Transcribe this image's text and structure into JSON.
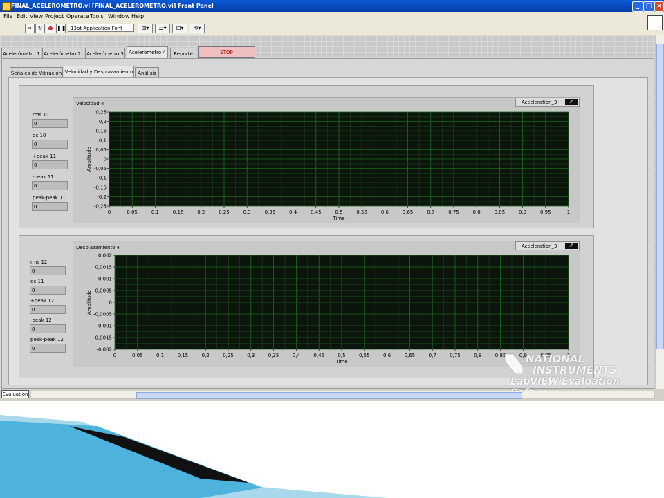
{
  "window": {
    "title": "FINAL_ACELEROMETRO.vi [FINAL_ACELEROMETRO.vi] Front Panel"
  },
  "menu": [
    "File",
    "Edit",
    "View",
    "Project",
    "Operate",
    "Tools",
    "Window",
    "Help"
  ],
  "toolbar": {
    "font": "13pt Application Font"
  },
  "tabs": [
    {
      "label": "Acelerómetro 1",
      "active": false
    },
    {
      "label": "Acelerómetro 2",
      "active": false
    },
    {
      "label": "Acelerómetro 3",
      "active": false
    },
    {
      "label": "Acelerómetro 4",
      "active": true
    },
    {
      "label": "Reporte",
      "active": false
    }
  ],
  "stop_label": "STOP",
  "subtabs": [
    {
      "label": "Señales de Vibración",
      "active": false
    },
    {
      "label": "Velocidad y Desplazamiento",
      "active": true
    },
    {
      "label": "Análisis",
      "active": false
    }
  ],
  "velocity_panel": {
    "indicators": [
      {
        "label": "rms 11",
        "value": "0"
      },
      {
        "label": "dc 10",
        "value": "0"
      },
      {
        "label": "+peak 11",
        "value": "0"
      },
      {
        "label": "-peak 11",
        "value": "0"
      },
      {
        "label": "peak-peak 11",
        "value": "0"
      }
    ],
    "legend": "Acceleration_3"
  },
  "displacement_panel": {
    "indicators": [
      {
        "label": "rms 12",
        "value": "0"
      },
      {
        "label": "dc 11",
        "value": "0"
      },
      {
        "label": "+peak 12",
        "value": "0"
      },
      {
        "label": "-peak 12",
        "value": "0"
      },
      {
        "label": "peak-peak 12",
        "value": "0"
      }
    ],
    "legend": "Acceleration_3"
  },
  "chart_data": [
    {
      "type": "line",
      "title": "Velocidad 4",
      "xlabel": "Time",
      "ylabel": "Amplitude",
      "xlim": [
        0,
        1
      ],
      "ylim": [
        -0.25,
        0.25
      ],
      "xticks": [
        "0",
        "0,05",
        "0,1",
        "0,15",
        "0,2",
        "0,25",
        "0,3",
        "0,35",
        "0,4",
        "0,45",
        "0,5",
        "0,55",
        "0,6",
        "0,65",
        "0,7",
        "0,75",
        "0,8",
        "0,85",
        "0,9",
        "0,95",
        "1"
      ],
      "yticks": [
        "0,25",
        "0,2",
        "0,15",
        "0,1",
        "0,05",
        "0",
        "-0,05",
        "-0,1",
        "-0,15",
        "-0,2",
        "-0,25"
      ],
      "grid": true,
      "series": [
        {
          "name": "Acceleration_3",
          "values": []
        }
      ]
    },
    {
      "type": "line",
      "title": "Desplazamiento 4",
      "xlabel": "Time",
      "ylabel": "Amplitude",
      "xlim": [
        0,
        1
      ],
      "ylim": [
        -0.002,
        0.002
      ],
      "xticks": [
        "0",
        "0,05",
        "0,1",
        "0,15",
        "0,2",
        "0,25",
        "0,3",
        "0,35",
        "0,4",
        "0,45",
        "0,5",
        "0,55",
        "0,6",
        "0,65",
        "0,7",
        "0,75",
        "0,8",
        "0,85",
        "0,9",
        "0,95",
        "1"
      ],
      "yticks": [
        "0,002",
        "0,0015",
        "0,001",
        "0,0005",
        "0",
        "-0,0005",
        "-0,001",
        "-0,0015",
        "-0,002"
      ],
      "grid": true,
      "series": [
        {
          "name": "Acceleration_3",
          "values": []
        }
      ]
    }
  ],
  "status": {
    "evaluation": "Evaluation"
  },
  "watermark": {
    "line1": "NATIONAL",
    "line2": "INSTRUMENTS",
    "line3": "LabVIEW Evaluation Software"
  },
  "colors": {
    "plot_bg": "#0c150c",
    "grid": "#1f6a1f",
    "titlebar": "#0a5bd6"
  }
}
